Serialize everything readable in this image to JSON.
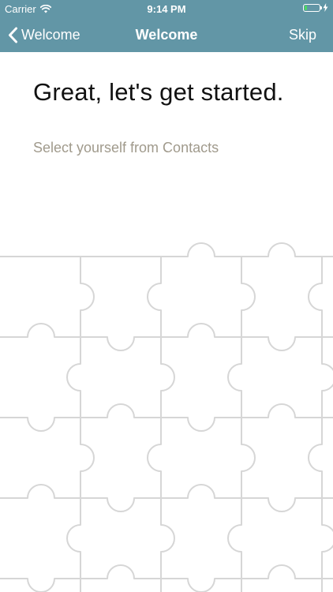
{
  "status_bar": {
    "carrier": "Carrier",
    "time": "9:14 PM",
    "battery_level": 0.15,
    "battery_color": "#4cd964"
  },
  "nav": {
    "back_label": "Welcome",
    "title": "Welcome",
    "skip_label": "Skip"
  },
  "content": {
    "headline": "Great, let's get started.",
    "select_contact_link": "Select yourself from Contacts"
  },
  "colors": {
    "header_bg": "#6296a6",
    "link_text": "#a09a8c",
    "puzzle_stroke": "#d6d6d6"
  },
  "icons": {
    "wifi": "wifi-icon",
    "battery": "battery-icon",
    "charging": "bolt-icon",
    "back": "chevron-left-icon",
    "background": "jigsaw-puzzle-pattern"
  }
}
